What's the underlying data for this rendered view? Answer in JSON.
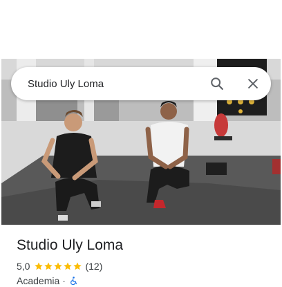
{
  "search": {
    "query": "Studio Uly Loma"
  },
  "icons": {
    "search": "search-icon",
    "close": "close-icon",
    "wheelchair": "wheelchair-accessible-icon",
    "star": "star-icon"
  },
  "place": {
    "name": "Studio Uly Loma",
    "rating": "5,0",
    "stars": 5,
    "review_count": "(12)",
    "category": "Academia",
    "separator": "·"
  },
  "colors": {
    "star": "#fbbc04",
    "accessible": "#1a73e8",
    "icon": "#5f6368"
  }
}
